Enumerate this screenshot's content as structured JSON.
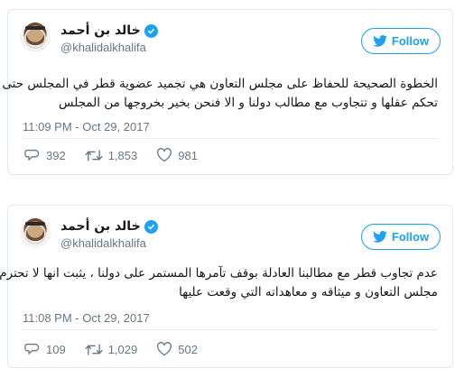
{
  "tweets": [
    {
      "display_name": "خالد بن أحمد",
      "handle": "@khalidalkhalifa",
      "follow_label": "Follow",
      "text_lines": [
        "الخطوة الصحيحة للحفاظ على مجلس التعاون هي تجميد عضوية قطر في المجلس حتى",
        "تحكم عقلها و تتجاوب مع مطالب دولنا و الا فنحن بخير بخروجها من المجلس"
      ],
      "timestamp": "11:09 PM - Oct 29, 2017",
      "replies": "392",
      "retweets": "1,853",
      "likes": "981"
    },
    {
      "display_name": "خالد بن أحمد",
      "handle": "@khalidalkhalifa",
      "follow_label": "Follow",
      "text_lines": [
        "عدم تجاوب قطر مع مطالبنا العادلة بوقف تآمرها المستمر على دولنا ، يثبت انها لا تحترم",
        "مجلس التعاون و ميثاقه و معاهداته التي وقعت عليها"
      ],
      "timestamp": "11:08 PM - Oct 29, 2017",
      "replies": "109",
      "retweets": "1,029",
      "likes": "502"
    }
  ],
  "icons": {
    "verified": "verified-badge-icon",
    "twitter_bird": "twitter-bird-icon",
    "reply": "reply-icon",
    "retweet": "retweet-icon",
    "like": "heart-icon"
  },
  "colors": {
    "accent": "#1da1f2",
    "text": "#14171a",
    "muted": "#657786",
    "border": "#e1e8ed"
  }
}
